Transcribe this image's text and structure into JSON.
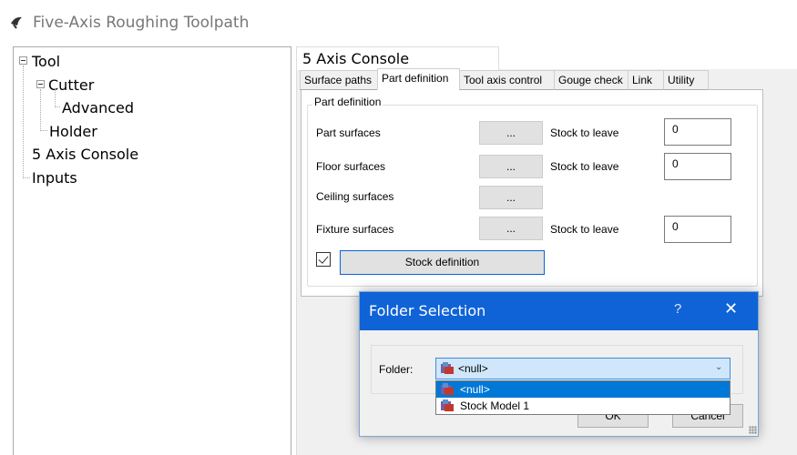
{
  "window": {
    "title": "Five-Axis Roughing Toolpath",
    "icon": "toolpath-app-icon"
  },
  "tree": {
    "items": [
      {
        "label": "Tool",
        "expandable": true
      },
      {
        "label": "Cutter",
        "expandable": true
      },
      {
        "label": "Advanced",
        "expandable": false
      },
      {
        "label": "Holder",
        "expandable": false
      },
      {
        "label": "5 Axis Console",
        "expandable": false
      },
      {
        "label": "Inputs",
        "expandable": false
      }
    ]
  },
  "console": {
    "title": "5 Axis Console",
    "tabs": [
      "Surface paths",
      "Part definition",
      "Tool axis control",
      "Gouge check",
      "Link",
      "Utility"
    ],
    "active_tab": "Part definition",
    "group_label": "Part definition",
    "rows": [
      {
        "label": "Part surfaces",
        "button": "...",
        "stock_label": "Stock to leave",
        "stock_value": "0"
      },
      {
        "label": "Floor surfaces",
        "button": "...",
        "stock_label": "Stock to leave",
        "stock_value": "0"
      },
      {
        "label": "Ceiling surfaces",
        "button": "..."
      },
      {
        "label": "Fixture surfaces",
        "button": "...",
        "stock_label": "Stock to leave",
        "stock_value": "0"
      }
    ],
    "stock_checkbox_checked": true,
    "stock_button": "Stock definition"
  },
  "dialog": {
    "title": "Folder Selection",
    "help": "?",
    "close": "✕",
    "folder_label": "Folder:",
    "selected": "<null>",
    "options": [
      "<null>",
      "Stock Model 1"
    ],
    "ok_label": "OK",
    "cancel_label": "Cancel"
  },
  "colors": {
    "dialog_titlebar": "#0f63d6",
    "selection": "#0078d7",
    "combo_bg": "#cfe6fb"
  }
}
